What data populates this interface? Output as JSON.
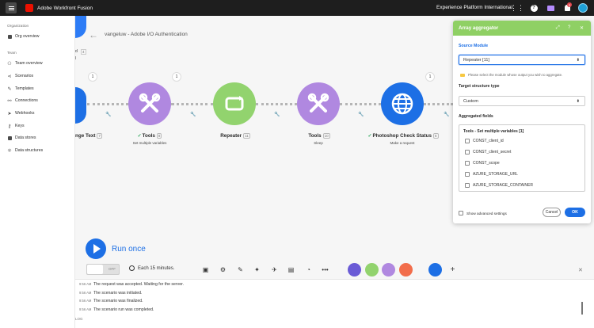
{
  "topbar": {
    "app_title": "Adobe Workfront Fusion",
    "org_name": "Experience Platform International",
    "notification_count": "1"
  },
  "sidebar": {
    "organization_header": "Organization",
    "org_overview": "Org overview",
    "team_header": "Team",
    "items": [
      {
        "label": "Team overview",
        "icon": "team-icon"
      },
      {
        "label": "Scenarios",
        "icon": "share-icon"
      },
      {
        "label": "Templates",
        "icon": "templates-icon"
      },
      {
        "label": "Connections",
        "icon": "link-icon"
      },
      {
        "label": "Webhooks",
        "icon": "webhook-icon"
      },
      {
        "label": "Keys",
        "icon": "key-icon"
      },
      {
        "label": "Data stores",
        "icon": "database-icon"
      },
      {
        "label": "Data structures",
        "icon": "structure-icon"
      }
    ]
  },
  "canvas": {
    "scenario_name": "vangeluw - Adobe I/O Authentication",
    "left_count": "4",
    "left_node_label": "nge Text",
    "left_node_id": "7",
    "nodes": [
      {
        "label": "Tools",
        "id": "8",
        "sub": "Set multiple variables",
        "bubble": "1",
        "color": "#b088e0"
      },
      {
        "label": "Repeater",
        "id": "11",
        "sub": "",
        "bubble": "",
        "color": "#92d36e"
      },
      {
        "label": "Tools",
        "id": "10",
        "sub": "Sleep",
        "bubble": "1",
        "color": "#b088e0"
      },
      {
        "label": "Photoshop Check Status",
        "id": "6",
        "sub": "Make a request",
        "bubble": "1",
        "color": "#1d6fe5"
      }
    ],
    "left_bubble": "1",
    "run_label": "Run once"
  },
  "toolbar": {
    "toggle_label": "OFF",
    "schedule": "Each 15 minutes."
  },
  "log": {
    "label": "LOG",
    "entries": [
      {
        "time": "9:56 AM",
        "message": "The request was accepted. Waiting for the server."
      },
      {
        "time": "9:56 AM",
        "message": "The scenario was initiated."
      },
      {
        "time": "9:56 AM",
        "message": "The scenario was finalized."
      },
      {
        "time": "9:56 AM",
        "message": "The scenario run was completed."
      }
    ]
  },
  "panel": {
    "title": "Array aggregator",
    "source_module_label": "Source Module",
    "source_module_value": "Repeater [11]",
    "hint": "Please select the module whose output you wish to aggregate.",
    "target_label": "Target structure type",
    "target_value": "Custom",
    "aggregated_label": "Aggregated fields",
    "aggregated_title": "Tools - Set multiple variables [1]",
    "fields": [
      "CONST_client_id",
      "CONST_client_secret",
      "CONST_scope",
      "AZURE_STORAGE_URL",
      "AZURE_STORAGE_CONTAINER"
    ],
    "advanced_label": "Show advanced settings",
    "cancel_label": "Cancel",
    "ok_label": "OK"
  },
  "colors": {
    "accent": "#1d6fe5",
    "panel_header": "#8fd064",
    "tools": "#b088e0",
    "repeater": "#92d36e"
  }
}
